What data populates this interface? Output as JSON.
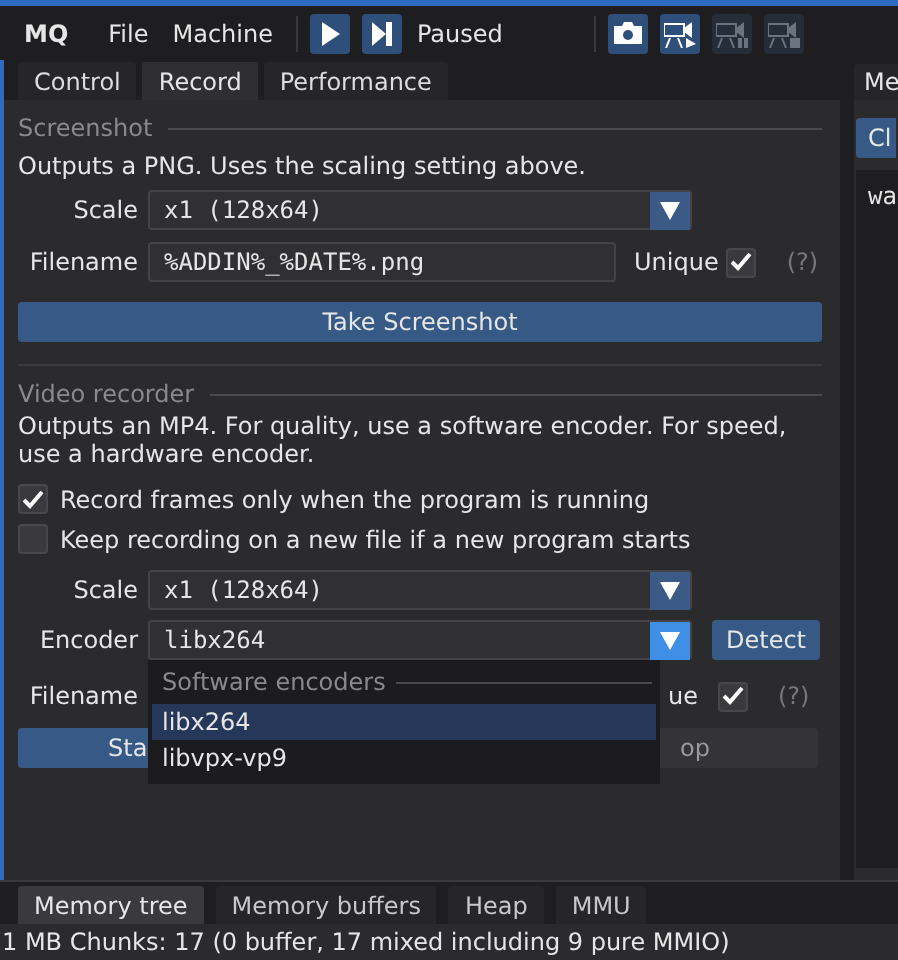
{
  "app": {
    "logo": "MQ",
    "menu": [
      {
        "label": "File"
      },
      {
        "label": "Machine"
      }
    ],
    "controls": [
      {
        "kind": "play",
        "enabled": true
      },
      {
        "kind": "step",
        "enabled": true
      }
    ],
    "status": "Paused",
    "record_tools": [
      {
        "kind": "camera",
        "enabled": true
      },
      {
        "kind": "record",
        "enabled": true
      },
      {
        "kind": "pause",
        "enabled": false
      },
      {
        "kind": "stop",
        "enabled": false
      }
    ]
  },
  "tabs": [
    {
      "label": "Control",
      "selected": false
    },
    {
      "label": "Record",
      "selected": true
    },
    {
      "label": "Performance",
      "selected": false
    }
  ],
  "screenshot": {
    "heading": "Screenshot",
    "description": "Outputs a PNG. Uses the scaling setting above.",
    "scale": {
      "label": "Scale",
      "value": "x1 (128x64)"
    },
    "filename": {
      "label": "Filename",
      "value": "%ADDIN%_%DATE%.png"
    },
    "unique": {
      "label": "Unique",
      "checked": true
    },
    "help": "(?)",
    "button": "Take Screenshot"
  },
  "video": {
    "heading": "Video recorder",
    "description": "Outputs an MP4. For quality, use a software encoder. For speed, use a hardware encoder.",
    "options": [
      {
        "label": "Record frames only when the program is running",
        "checked": true
      },
      {
        "label": "Keep recording on a new file if a new program starts",
        "checked": false
      }
    ],
    "scale": {
      "label": "Scale",
      "value": "x1 (128x64)"
    },
    "encoder": {
      "label": "Encoder",
      "value": "libx264",
      "open": true
    },
    "detect": "Detect",
    "filename": {
      "label": "Filename"
    },
    "unique": {
      "label": "ue",
      "checked": true
    },
    "help": "(?)",
    "buttons": [
      "Sta",
      "op"
    ]
  },
  "encoder_menu": {
    "group": "Software encoders",
    "items": [
      {
        "label": "libx264",
        "selected": true
      },
      {
        "label": "libvpx-vp9",
        "selected": false
      }
    ]
  },
  "side_panel": {
    "tab": "Me",
    "button": "Cl",
    "text": "wa"
  },
  "bottom_tabs": [
    {
      "label": "Memory tree",
      "selected": true
    },
    {
      "label": "Memory buffers",
      "selected": false
    },
    {
      "label": "Heap",
      "selected": false
    },
    {
      "label": "MMU",
      "selected": false
    }
  ],
  "status_line": "1 MB Chunks: 17 (0 buffer, 17 mixed including 9 pure MMIO)"
}
